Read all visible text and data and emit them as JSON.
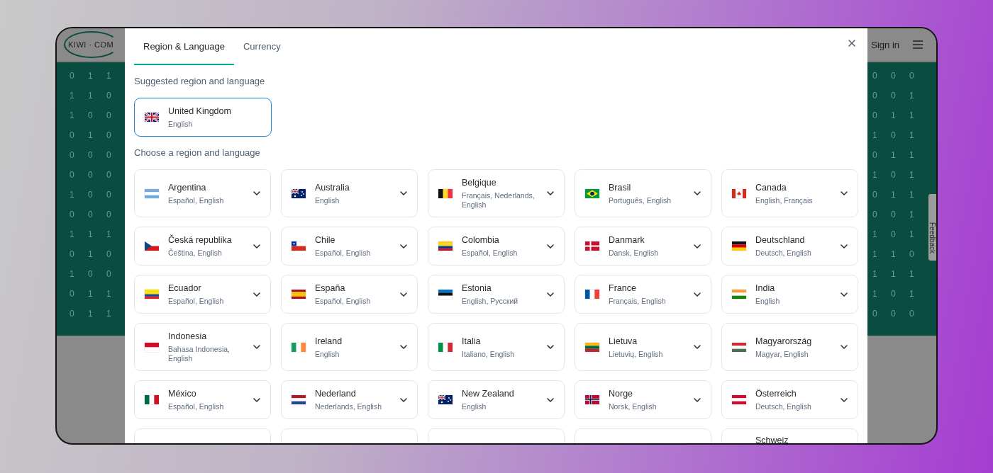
{
  "header": {
    "logo": "KIWI · COM",
    "sign_in": "Sign in"
  },
  "background": {
    "digits_left": [
      "0 1 1",
      "1 1 0",
      "1 0 0",
      "0 1 0",
      "0 0 0",
      "0 0 0",
      "1 0 0",
      "0 0 0",
      "1 1 1",
      "0 1 0",
      "1 0 0",
      "0 1 1",
      "0 1 1"
    ],
    "digits_right": [
      "0 0 0",
      "0 0 1",
      "0 1 1",
      "1 0 1",
      "0 1 1",
      "1 0 1",
      "0 1 1",
      "0 0 1",
      "1 0 1",
      "1 1 0",
      "1 1 1",
      "1 0 1",
      "0 0 0"
    ],
    "feedback_tab": "Feedback"
  },
  "modal": {
    "tabs": [
      {
        "label": "Region & Language",
        "selected": true
      },
      {
        "label": "Currency",
        "selected": false
      }
    ],
    "suggested_heading": "Suggested region and language",
    "suggested": {
      "name": "United Kingdom",
      "languages": "English",
      "selected": true
    },
    "choose_heading": "Choose a region and language",
    "regions": [
      {
        "name": "Argentina",
        "languages": "Español, English"
      },
      {
        "name": "Australia",
        "languages": "English"
      },
      {
        "name": "Belgique",
        "languages": "Français, Nederlands, English"
      },
      {
        "name": "Brasil",
        "languages": "Português, English"
      },
      {
        "name": "Canada",
        "languages": "English, Français"
      },
      {
        "name": "Česká republika",
        "languages": "Čeština, English"
      },
      {
        "name": "Chile",
        "languages": "Español, English"
      },
      {
        "name": "Colombia",
        "languages": "Español, English"
      },
      {
        "name": "Danmark",
        "languages": "Dansk, English"
      },
      {
        "name": "Deutschland",
        "languages": "Deutsch, English"
      },
      {
        "name": "Ecuador",
        "languages": "Español, English"
      },
      {
        "name": "España",
        "languages": "Español, English"
      },
      {
        "name": "Estonia",
        "languages": "English, Русский"
      },
      {
        "name": "France",
        "languages": "Français, English"
      },
      {
        "name": "India",
        "languages": "English"
      },
      {
        "name": "Indonesia",
        "languages": "Bahasa Indonesia, English"
      },
      {
        "name": "Ireland",
        "languages": "English"
      },
      {
        "name": "Italia",
        "languages": "Italiano, English"
      },
      {
        "name": "Lietuva",
        "languages": "Lietuvių, English"
      },
      {
        "name": "Magyarország",
        "languages": "Magyar, English"
      },
      {
        "name": "México",
        "languages": "Español, English"
      },
      {
        "name": "Nederland",
        "languages": "Nederlands, English"
      },
      {
        "name": "New Zealand",
        "languages": "English"
      },
      {
        "name": "Norge",
        "languages": "Norsk, English"
      },
      {
        "name": "Österreich",
        "languages": "Deutsch, English"
      }
    ],
    "partial_row": [
      {
        "kind": "blank"
      },
      {
        "kind": "blank"
      },
      {
        "kind": "blank"
      },
      {
        "kind": "blank"
      },
      {
        "kind": "named",
        "name": "Schweiz"
      }
    ]
  }
}
